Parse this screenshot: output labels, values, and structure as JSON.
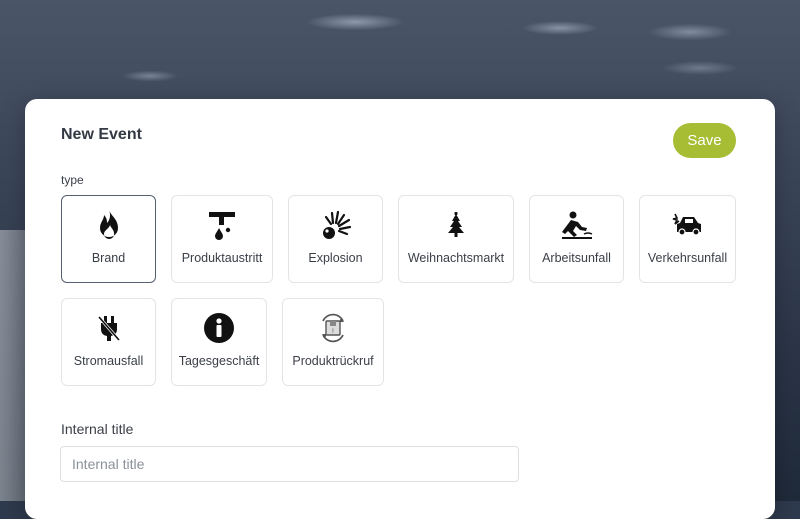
{
  "modal": {
    "title": "New Event",
    "save_label": "Save",
    "type_label": "type"
  },
  "event_types": [
    {
      "label": "Brand",
      "icon": "fire-icon",
      "selected": true
    },
    {
      "label": "Produktaustritt",
      "icon": "leak-icon",
      "selected": false
    },
    {
      "label": "Explosion",
      "icon": "explosion-icon",
      "selected": false
    },
    {
      "label": "Weihnachtsmarkt",
      "icon": "christmas-tree-icon",
      "selected": false
    },
    {
      "label": "Arbeitsunfall",
      "icon": "slip-fall-icon",
      "selected": false
    },
    {
      "label": "Verkehrsunfall",
      "icon": "car-crash-icon",
      "selected": false
    },
    {
      "label": "Stromausfall",
      "icon": "power-outage-icon",
      "selected": false
    },
    {
      "label": "Tagesgeschäft",
      "icon": "info-icon",
      "selected": false
    },
    {
      "label": "Produktrückruf",
      "icon": "product-recall-icon",
      "selected": false
    }
  ],
  "internal_title": {
    "label": "Internal title",
    "placeholder": "Internal title",
    "value": ""
  },
  "colors": {
    "accent": "#a7bd34",
    "selected_border": "#556070"
  }
}
